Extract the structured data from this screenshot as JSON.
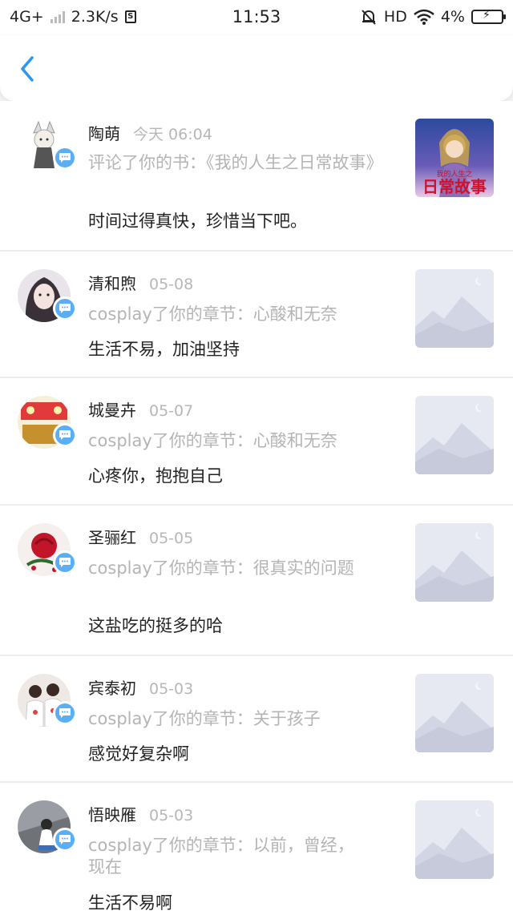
{
  "status_bar": {
    "network": "4G+",
    "speed": "2.3K/s",
    "sim_label": "S",
    "time": "11:53",
    "hd": "HD",
    "battery": "4%"
  },
  "nav": {
    "back_icon": "chevron-left-icon"
  },
  "colors": {
    "accent": "#2b95ef",
    "badge": "#5aaef5",
    "muted": "#b4b4b4"
  },
  "notifications": [
    {
      "name": "陶萌",
      "time": "今天 06:04",
      "action": "评论了你的书：《我的人生之日常故事》",
      "comment": "时间过得真快，珍惜当下吧。",
      "thumb_type": "book-cover",
      "cover_small": "我的人生之",
      "cover_title": "日常故事"
    },
    {
      "name": "清和煦",
      "time": "05-08",
      "action": "cosplay了你的章节：心酸和无奈",
      "comment": "生活不易，加油坚持",
      "thumb_type": "placeholder"
    },
    {
      "name": "城曼卉",
      "time": "05-07",
      "action": "cosplay了你的章节：心酸和无奈",
      "comment": "心疼你，抱抱自己",
      "thumb_type": "placeholder"
    },
    {
      "name": "圣骊红",
      "time": "05-05",
      "action": "cosplay了你的章节：很真实的问题",
      "comment": "这盐吃的挺多的哈",
      "thumb_type": "placeholder"
    },
    {
      "name": "宾泰初",
      "time": "05-03",
      "action": "cosplay了你的章节：关于孩子",
      "comment": "感觉好复杂啊",
      "thumb_type": "placeholder"
    },
    {
      "name": "悟映雁",
      "time": "05-03",
      "action": "cosplay了你的章节：以前，曾经，现在",
      "comment": "生活不易啊",
      "thumb_type": "placeholder"
    }
  ]
}
